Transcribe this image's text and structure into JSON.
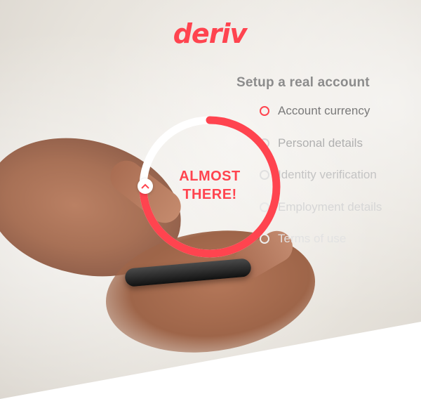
{
  "brand": {
    "logo_text": "deriv",
    "color": "#ff444f"
  },
  "setup": {
    "title": "Setup a real account",
    "steps": [
      {
        "label": "Account currency",
        "state": "active"
      },
      {
        "label": "Personal details",
        "state": "pending"
      },
      {
        "label": "Identity verification",
        "state": "pending"
      },
      {
        "label": "Employment details",
        "state": "pending"
      },
      {
        "label": "Terms of use",
        "state": "pending"
      }
    ]
  },
  "progress": {
    "line1": "ALMOST",
    "line2": "THERE!",
    "fraction": 0.75,
    "indicator_icon": "chevron-up-icon"
  }
}
